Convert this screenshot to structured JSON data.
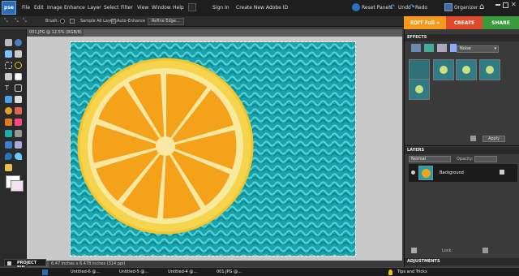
{
  "app": {
    "logo_text": "pse"
  },
  "menu": {
    "items": [
      "File",
      "Edit",
      "Image",
      "Enhance",
      "Layer",
      "Select",
      "Filter",
      "View",
      "Window",
      "Help"
    ],
    "sign_in": "Sign In",
    "create_id": "Create New Adobe ID"
  },
  "right_tools": {
    "reset_panels": "Reset Panels",
    "undo": "Undo",
    "redo": "Redo",
    "organizer": "Organizer"
  },
  "options": {
    "brush_label": "Brush:",
    "sample_all": "Sample All Layers",
    "auto_enhance": "Auto-Enhance",
    "refine_edge": "Refine Edge..."
  },
  "tabs": {
    "edit": "EDIT Full",
    "create": "CREATE",
    "share": "SHARE"
  },
  "document": {
    "tab_title": "001.JPG @ 12.5% (RGB/8)",
    "status": "6.47 inches x 6.478 inches (314 ppi)"
  },
  "effects": {
    "header": "EFFECTS",
    "dropdown": "Noise",
    "apply": "Apply"
  },
  "layers": {
    "header": "LAYERS",
    "blend_mode": "Normal",
    "opacity_label": "Opacity:",
    "lock_label": "Lock:",
    "background_layer": "Background"
  },
  "adjustments": {
    "header": "ADJUSTMENTS"
  },
  "project_bin": {
    "label": "PROJECT BIN"
  },
  "taskbar": {
    "items": [
      "Untitled-6 @...",
      "Untitled-5 @...",
      "Untitled-4 @...",
      "001.JPG @..."
    ],
    "tips": "Tips and Tricks"
  },
  "colors": {
    "accent": "#f59a1d",
    "create": "#e04a2b",
    "share": "#3a9a3a",
    "teal": "#1aa2aa",
    "orange": "#f4a21a"
  }
}
